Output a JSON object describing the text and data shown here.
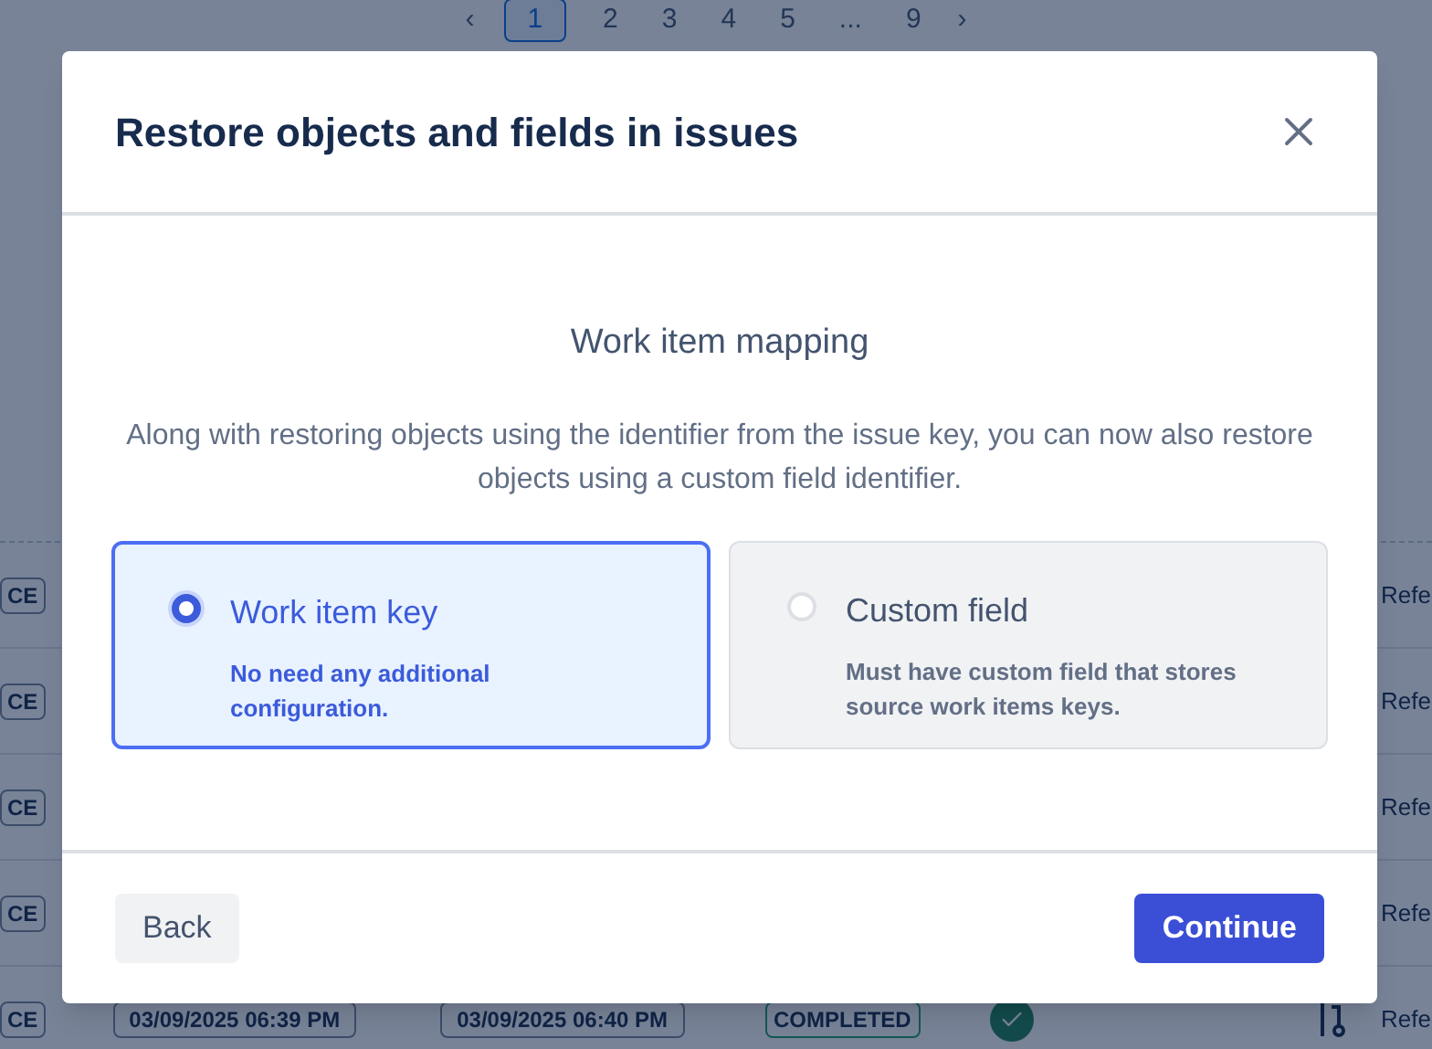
{
  "pagination": {
    "previous": "‹",
    "next": "›",
    "pages": [
      {
        "label": "1",
        "selected": true
      },
      {
        "label": "2",
        "selected": false
      },
      {
        "label": "3",
        "selected": false
      },
      {
        "label": "4",
        "selected": false
      },
      {
        "label": "5",
        "selected": false
      },
      {
        "label": "...",
        "selected": false
      },
      {
        "label": "9",
        "selected": false
      }
    ]
  },
  "rows": [
    {
      "badge": "CE",
      "reference": "Refe"
    },
    {
      "badge": "CE",
      "reference": "Refe"
    },
    {
      "badge": "CE",
      "reference": "Refe"
    },
    {
      "badge": "CE",
      "reference": "Refe"
    },
    {
      "badge": "CE",
      "started": "03/09/2025 06:39 PM",
      "finished": "03/09/2025 06:40 PM",
      "status": "COMPLETED",
      "reference": "Refe"
    }
  ],
  "dialog": {
    "title": "Restore objects and fields in issues",
    "heading": "Work item mapping",
    "description": "Along with restoring objects using the identifier from the issue key, you can now also restore objects using a custom field identifier.",
    "options": [
      {
        "label": "Work item key",
        "hint": "No need any additional configuration.",
        "selected": true
      },
      {
        "label": "Custom field",
        "hint": "Must have custom field that stores source work items keys.",
        "selected": false
      }
    ],
    "back": "Back",
    "continue": "Continue"
  }
}
